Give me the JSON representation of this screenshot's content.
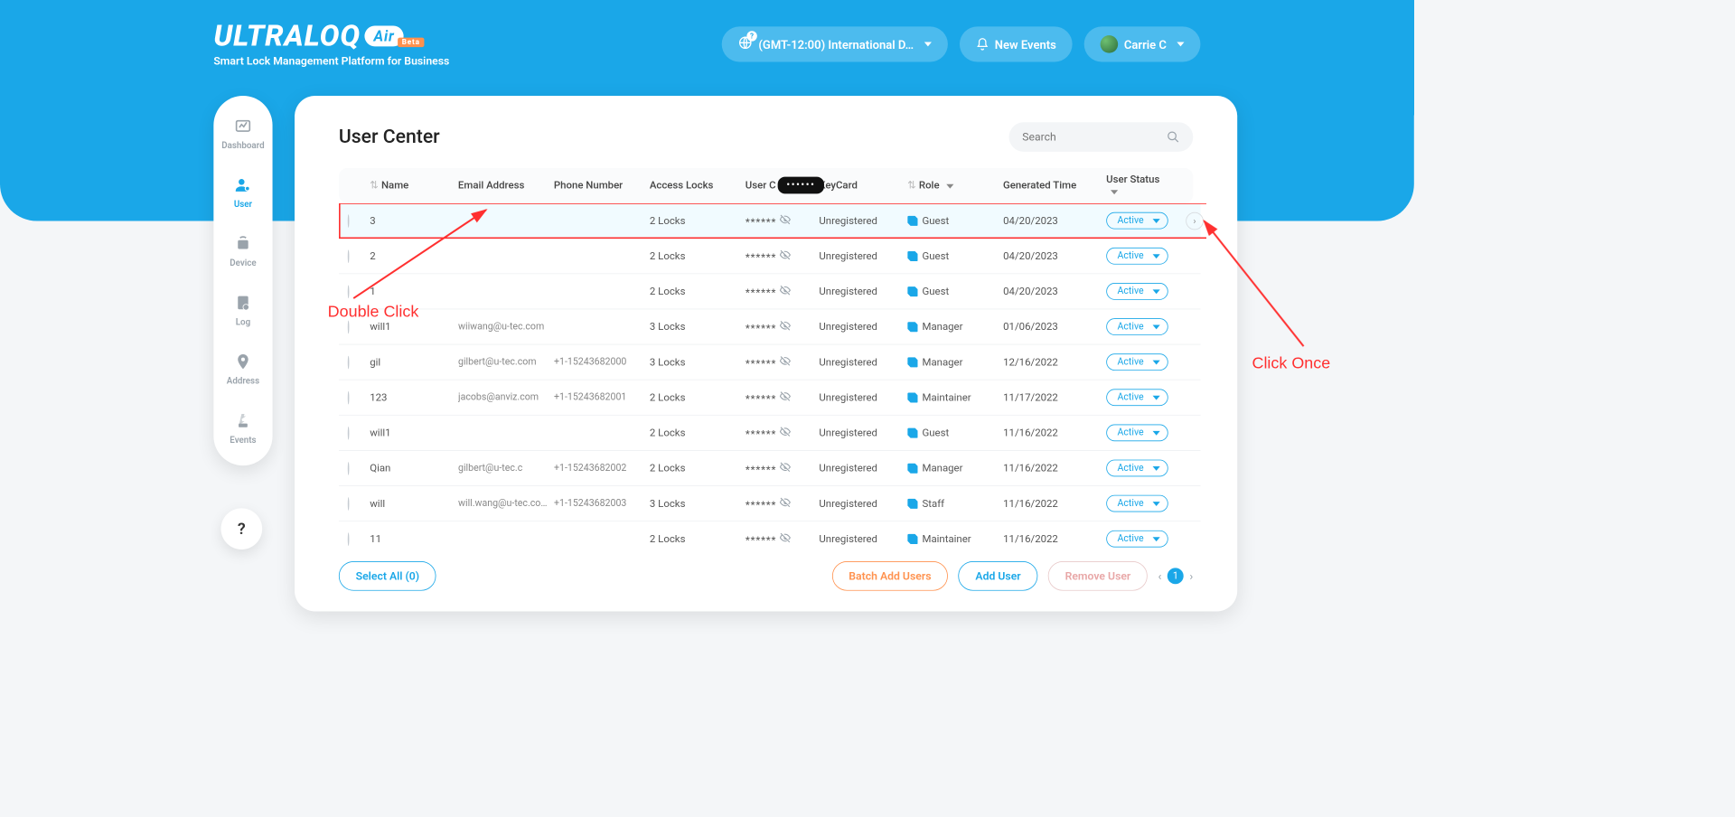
{
  "brand": {
    "name": "ULTRALOQ",
    "air": "Air",
    "beta": "Beta",
    "subtitle": "Smart Lock Management Platform for Business"
  },
  "header": {
    "timezone": "(GMT-12:00) International D…",
    "new_events": "New Events",
    "user_name": "Carrie C"
  },
  "sidebar": [
    {
      "label": "Dashboard"
    },
    {
      "label": "User"
    },
    {
      "label": "Device"
    },
    {
      "label": "Log"
    },
    {
      "label": "Address"
    },
    {
      "label": "Events"
    }
  ],
  "help": "?",
  "page": {
    "title": "User Center",
    "search_placeholder": "Search"
  },
  "columns": {
    "name": "Name",
    "email": "Email Address",
    "phone": "Phone Number",
    "locks": "Access Locks",
    "code": "User C",
    "keycard": "KeyCard",
    "role": "Role",
    "generated": "Generated Time",
    "status": "User Status"
  },
  "redacted_header": "••••••",
  "rows": [
    {
      "name": "3",
      "email": "",
      "phone": "",
      "locks": "2 Locks",
      "code": "******",
      "keycard": "Unregistered",
      "role": "Guest",
      "gen": "04/20/2023",
      "status": "Active",
      "selected": true
    },
    {
      "name": "2",
      "email": "",
      "phone": "",
      "locks": "2 Locks",
      "code": "******",
      "keycard": "Unregistered",
      "role": "Guest",
      "gen": "04/20/2023",
      "status": "Active"
    },
    {
      "name": "1",
      "email": "",
      "phone": "",
      "locks": "2 Locks",
      "code": "******",
      "keycard": "Unregistered",
      "role": "Guest",
      "gen": "04/20/2023",
      "status": "Active"
    },
    {
      "name": "will1",
      "email": "wiiwang@u-tec.com",
      "phone": "",
      "locks": "3 Locks",
      "code": "******",
      "keycard": "Unregistered",
      "role": "Manager",
      "gen": "01/06/2023",
      "status": "Active"
    },
    {
      "name": "gil",
      "email": "gilbert@u-tec.com",
      "phone": "+1-15243682000",
      "locks": "3 Locks",
      "code": "******",
      "keycard": "Unregistered",
      "role": "Manager",
      "gen": "12/16/2022",
      "status": "Active"
    },
    {
      "name": "123",
      "email": "jacobs@anviz.com",
      "phone": "+1-15243682001",
      "locks": "2 Locks",
      "code": "******",
      "keycard": "Unregistered",
      "role": "Maintainer",
      "gen": "11/17/2022",
      "status": "Active"
    },
    {
      "name": "will1",
      "email": "",
      "phone": "",
      "locks": "2 Locks",
      "code": "******",
      "keycard": "Unregistered",
      "role": "Guest",
      "gen": "11/16/2022",
      "status": "Active"
    },
    {
      "name": "Qian",
      "email": "gilbert@u-tec.c",
      "phone": "+1-15243682002",
      "locks": "2 Locks",
      "code": "******",
      "keycard": "Unregistered",
      "role": "Manager",
      "gen": "11/16/2022",
      "status": "Active"
    },
    {
      "name": "will",
      "email": "will.wang@u-tec.co…",
      "phone": "+1-15243682003",
      "locks": "3 Locks",
      "code": "******",
      "keycard": "Unregistered",
      "role": "Staff",
      "gen": "11/16/2022",
      "status": "Active"
    },
    {
      "name": "11",
      "email": "",
      "phone": "",
      "locks": "2 Locks",
      "code": "******",
      "keycard": "Unregistered",
      "role": "Maintainer",
      "gen": "11/16/2022",
      "status": "Active"
    }
  ],
  "footer": {
    "select_all": "Select All (0)",
    "batch_add": "Batch Add Users",
    "add_user": "Add User",
    "remove_user": "Remove User",
    "page": "1"
  },
  "annotations": {
    "double_click": "Double Click",
    "click_once": "Click Once"
  }
}
